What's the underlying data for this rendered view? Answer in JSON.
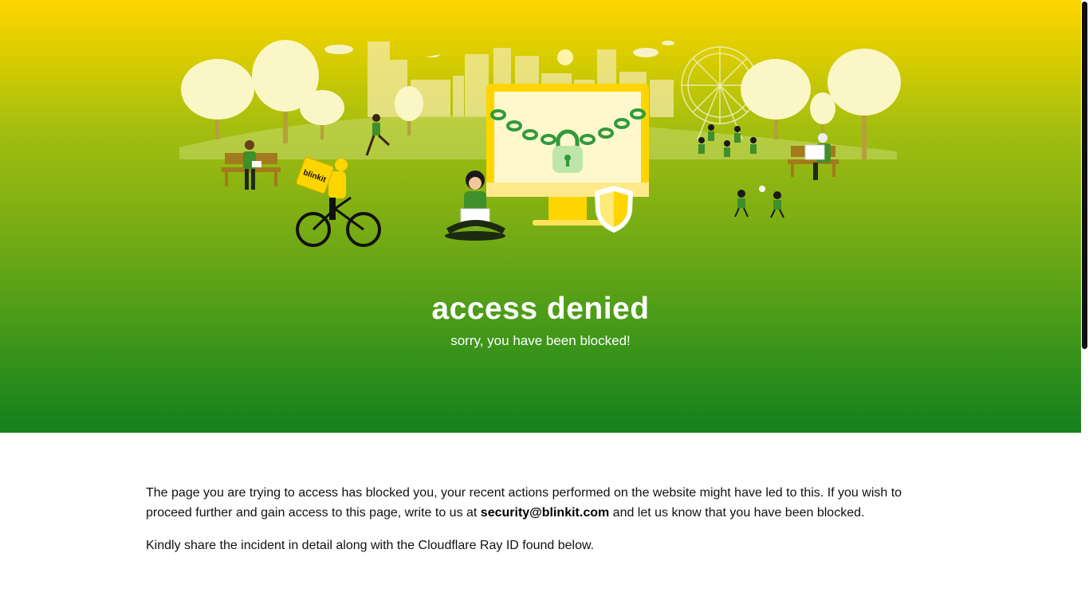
{
  "hero": {
    "title": "access denied",
    "subtitle": "sorry, you have been blocked!",
    "illustration": {
      "brand_badge": "blinkit",
      "icons": [
        "padlock-icon",
        "shield-icon",
        "chain-icon",
        "ferris-wheel-icon",
        "bicycle-icon"
      ]
    }
  },
  "body": {
    "paragraph1_before_email": "The page you are trying to access has blocked you, your recent actions performed on the website might have led to this. If you wish to proceed further and gain access to this page, write to us at ",
    "email": "security@blinkit.com",
    "paragraph1_after_email": " and let us know that you have been blocked.",
    "paragraph2": "Kindly share the incident in detail along with the Cloudflare Ray ID found below."
  },
  "colors": {
    "gradient_top": "#ffd500",
    "gradient_bottom": "#15801d",
    "text": "#111111",
    "hero_text": "#ffffff"
  }
}
